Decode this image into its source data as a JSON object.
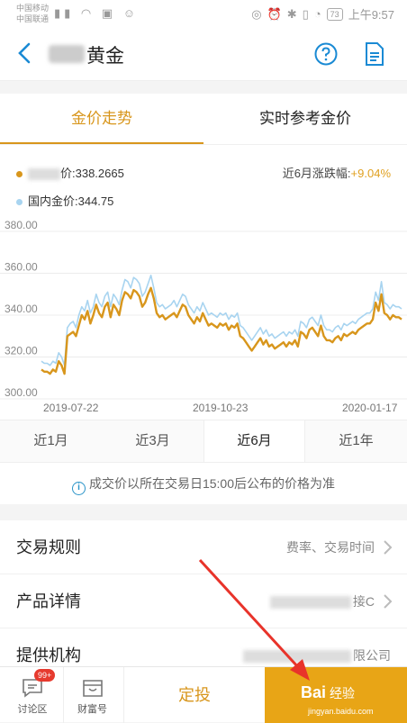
{
  "status_bar": {
    "carrier1": "中国移动",
    "carrier2": "中国联通",
    "battery": "73",
    "time": "上午9:57"
  },
  "header": {
    "title": "黄金",
    "back_icon": "chevron-left-icon",
    "help_icon": "help-circle-icon",
    "doc_icon": "document-icon"
  },
  "tabs": [
    {
      "label": "金价走势",
      "active": true
    },
    {
      "label": "实时参考金价",
      "active": false
    }
  ],
  "legend": {
    "series1_label": "价:338.2665",
    "series2_label": "国内金价:344.75",
    "change_label": "近6月涨跌幅:",
    "change_value": "+9.04%"
  },
  "chart_data": {
    "type": "line",
    "y_ticks": [
      "380.00",
      "360.00",
      "340.00",
      "320.00",
      "300.00"
    ],
    "ylim": [
      300,
      380
    ],
    "x_tick_labels": [
      "2019-07-22",
      "2019-10-23",
      "2020-01-17"
    ],
    "series": [
      {
        "color": "#d8961c",
        "values": [
          314,
          313,
          313,
          312,
          314,
          313,
          318,
          316,
          312,
          330,
          331,
          332,
          330,
          335,
          340,
          338,
          342,
          336,
          340,
          345,
          341,
          339,
          344,
          346,
          339,
          345,
          343,
          340,
          347,
          351,
          350,
          348,
          352,
          351,
          349,
          344,
          346,
          350,
          353,
          348,
          341,
          339,
          340,
          338,
          339,
          340,
          341,
          339,
          342,
          345,
          344,
          340,
          338,
          336,
          339,
          337,
          341,
          338,
          335,
          336,
          335,
          334,
          336,
          335,
          336,
          333,
          335,
          334,
          336,
          330,
          329,
          327,
          325,
          323,
          325,
          327,
          329,
          326,
          328,
          325,
          326,
          324,
          325,
          326,
          327,
          325,
          327,
          326,
          328,
          325,
          332,
          331,
          329,
          333,
          334,
          332,
          330,
          335,
          330,
          328,
          328,
          327,
          329,
          330,
          328,
          331,
          330,
          331,
          332,
          331,
          333,
          334,
          335,
          336,
          336,
          338,
          346,
          342,
          350,
          341,
          340,
          338,
          340,
          339,
          339,
          338
        ]
      },
      {
        "color": "#a8d4f0",
        "values": [
          318,
          317,
          317,
          316,
          318,
          317,
          322,
          320,
          316,
          334,
          336,
          337,
          334,
          340,
          344,
          342,
          347,
          341,
          344,
          350,
          346,
          344,
          349,
          351,
          344,
          350,
          348,
          345,
          352,
          357,
          356,
          353,
          358,
          357,
          355,
          349,
          351,
          355,
          359,
          353,
          346,
          344,
          345,
          343,
          344,
          345,
          347,
          344,
          347,
          350,
          349,
          345,
          343,
          341,
          344,
          342,
          346,
          343,
          340,
          341,
          340,
          339,
          341,
          340,
          341,
          338,
          340,
          339,
          341,
          335,
          334,
          332,
          330,
          328,
          330,
          332,
          334,
          331,
          333,
          330,
          331,
          329,
          330,
          331,
          332,
          330,
          332,
          331,
          333,
          330,
          337,
          336,
          334,
          338,
          339,
          337,
          335,
          340,
          335,
          333,
          333,
          332,
          334,
          335,
          333,
          336,
          335,
          336,
          337,
          336,
          338,
          339,
          340,
          341,
          341,
          343,
          351,
          347,
          356,
          346,
          345,
          343,
          345,
          344,
          344,
          343
        ]
      }
    ]
  },
  "ranges": [
    {
      "label": "近1月",
      "active": false
    },
    {
      "label": "近3月",
      "active": false
    },
    {
      "label": "近6月",
      "active": true
    },
    {
      "label": "近1年",
      "active": false
    }
  ],
  "notice": "成交价以所在交易日15:00后公布的价格为准",
  "list": [
    {
      "label": "交易规则",
      "value": "费率、交易时间"
    },
    {
      "label": "产品详情",
      "value": "接C"
    },
    {
      "label": "提供机构",
      "value": "限公司"
    }
  ],
  "bottom_bar": {
    "forum_label": "讨论区",
    "forum_badge": "99+",
    "wealth_label": "财富号",
    "dingtou_label": "定投",
    "watermark": "Bai",
    "watermark_tail": "经验",
    "watermark_sub": "jingyan.baidu.com"
  },
  "colors": {
    "accent": "#d8961c",
    "secondary_line": "#a8d4f0",
    "buy_bg": "#e8a516",
    "link_blue": "#1a8ad4"
  }
}
